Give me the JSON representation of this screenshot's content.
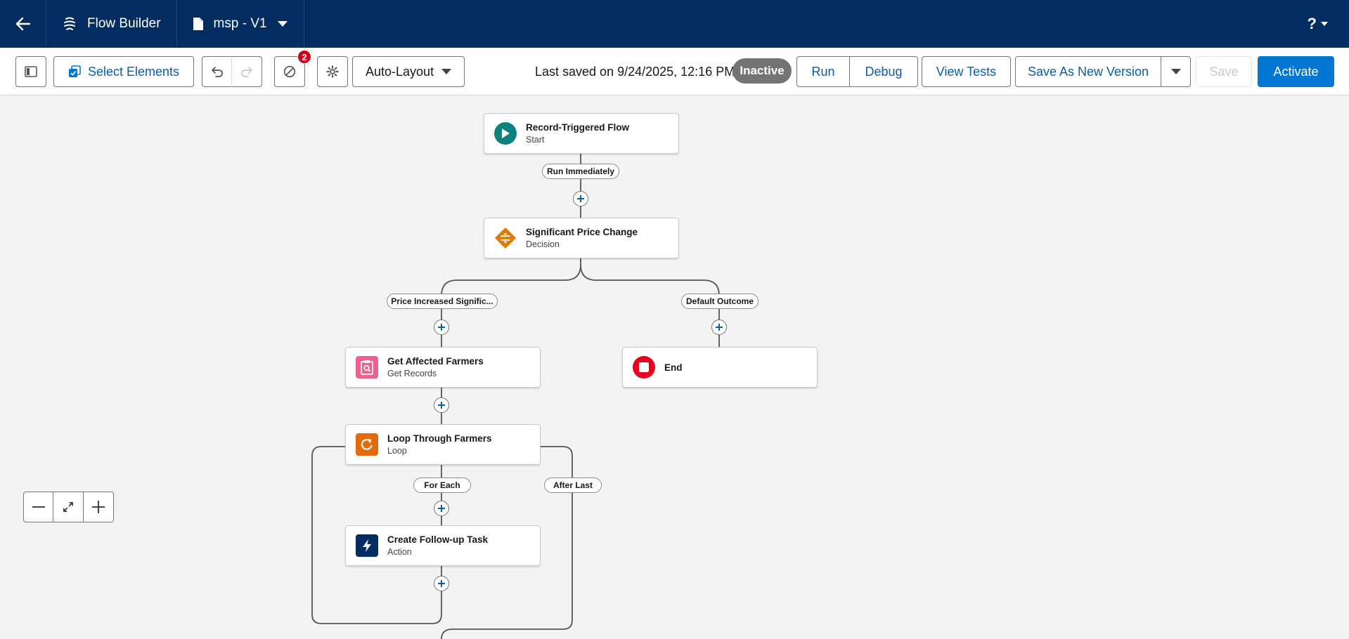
{
  "topbar": {
    "app_name": "Flow Builder",
    "file_name": "msp - V1",
    "help": "?"
  },
  "toolbar": {
    "select_elements": "Select Elements",
    "layout_select": "Auto-Layout",
    "error_count": "2",
    "last_saved": "Last saved on 9/24/2025, 12:16 PM",
    "status": "Inactive",
    "run": "Run",
    "debug": "Debug",
    "view_tests": "View Tests",
    "save_as_new": "Save As New Version",
    "save": "Save",
    "activate": "Activate"
  },
  "canvas": {
    "nodes": {
      "start": {
        "title": "Record-Triggered Flow",
        "subtitle": "Start"
      },
      "decision": {
        "title": "Significant Price Change",
        "subtitle": "Decision"
      },
      "get_records": {
        "title": "Get Affected Farmers",
        "subtitle": "Get Records"
      },
      "end": {
        "title": "End"
      },
      "loop": {
        "title": "Loop Through Farmers",
        "subtitle": "Loop"
      },
      "action": {
        "title": "Create Follow-up Task",
        "subtitle": "Action"
      }
    },
    "labels": {
      "run_immediately": "Run Immediately",
      "price_increased": "Price Increased Signific...",
      "default_outcome": "Default Outcome",
      "for_each": "For Each",
      "after_last": "After Last"
    }
  },
  "colors": {
    "header_bg": "#032d60",
    "brand": "#0176d3",
    "start_icon": "#0b827c",
    "decision_icon": "#dd7a01",
    "get_records_icon": "#f0608d",
    "end_icon": "#ea001e",
    "loop_icon": "#e46b0b",
    "action_icon": "#032d60"
  }
}
